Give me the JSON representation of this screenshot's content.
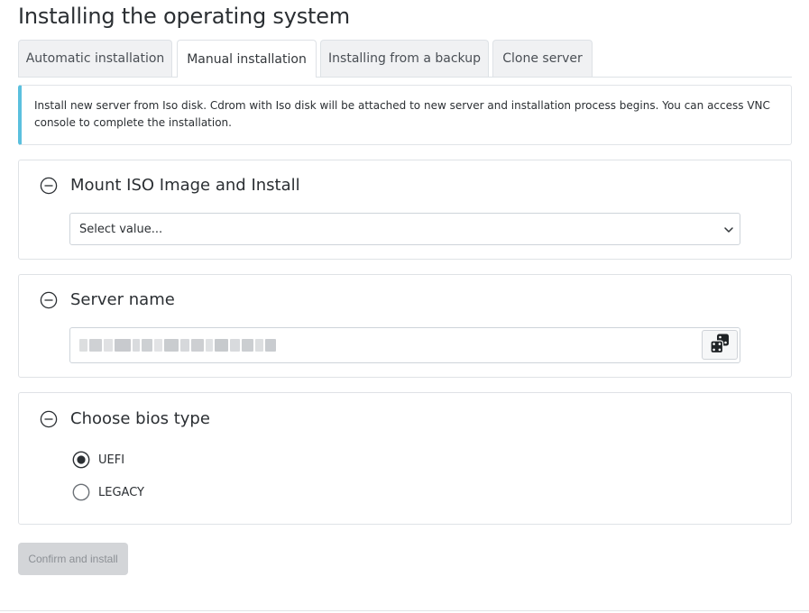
{
  "page": {
    "title": "Installing the operating system"
  },
  "tabs": [
    {
      "label": "Automatic installation",
      "active": false
    },
    {
      "label": "Manual installation",
      "active": true
    },
    {
      "label": "Installing from a backup",
      "active": false
    },
    {
      "label": "Clone server",
      "active": false
    }
  ],
  "info": {
    "text": "Install new server from Iso disk. Cdrom with Iso disk will be attached to new server and installation process begins. You can access VNC console to complete the installation.",
    "accent_color": "#5bc0de"
  },
  "iso_section": {
    "title": "Mount ISO Image and Install",
    "select_value": "Select value...",
    "icon": "collapse-minus-icon"
  },
  "name_section": {
    "title": "Server name",
    "value": "redacted-server-name",
    "generate_icon": "dice-icon",
    "icon": "collapse-minus-icon"
  },
  "bios_section": {
    "title": "Choose bios type",
    "icon": "collapse-minus-icon",
    "options": [
      {
        "label": "UEFI",
        "selected": true
      },
      {
        "label": "LEGACY",
        "selected": false
      }
    ]
  },
  "actions": {
    "confirm_label": "Confirm and install",
    "confirm_disabled": true
  }
}
